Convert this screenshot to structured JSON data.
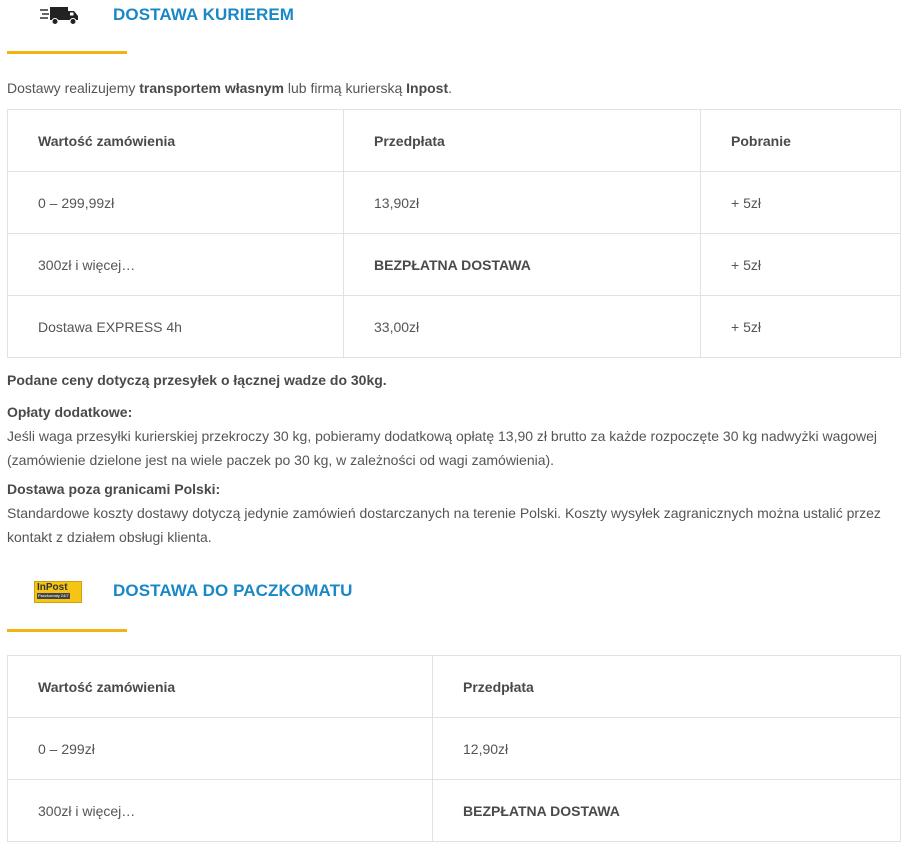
{
  "courier": {
    "title": "DOSTAWA KURIEREM",
    "icon": "truck-icon",
    "intro": {
      "t1": "Dostawy realizujemy ",
      "b1": "transportem własnym",
      "t2": " lub firmą kurierską ",
      "b2": "Inpost",
      "t3": "."
    },
    "table": {
      "headers": [
        "Wartość zamówienia",
        "Przedpłata",
        "Pobranie"
      ],
      "rows": [
        [
          "0 – 299,99zł",
          "13,90zł",
          "+ 5zł"
        ],
        [
          "300zł i więcej…",
          "BEZPŁATNA DOSTAWA",
          "+ 5zł"
        ],
        [
          "Dostawa EXPRESS 4h",
          "33,00zł",
          "+ 5zł"
        ]
      ]
    },
    "weight_note": "Podane ceny dotyczą przesyłek o łącznej wadze do 30kg.",
    "extra_fees": {
      "title": "Opłaty dodatkowe:",
      "line1": "Jeśli waga przesyłki kurierskiej przekroczy 30 kg, pobieramy dodatkową opłatę 13,90 zł brutto za każde rozpoczęte 30 kg nadwyżki wagowej",
      "line2": "(zamówienie dzielone jest na wiele paczek po 30 kg, w zależności od wagi zamówienia)."
    },
    "abroad": {
      "title": "Dostawa poza granicami Polski:",
      "line1": "Standardowe koszty dostawy dotyczą jedynie zamówień dostarczanych na terenie Polski. Koszty wysyłek zagranicznych można ustalić przez",
      "line2": "kontakt z działem obsługi klienta."
    }
  },
  "parcel": {
    "title": "DOSTAWA DO PACZKOMATU",
    "logo": {
      "text": "InPost",
      "sub": "Paczkomaty 24/7"
    },
    "table": {
      "headers": [
        "Wartość zamówienia",
        "Przedpłata"
      ],
      "rows": [
        [
          "0 – 299zł",
          "12,90zł"
        ],
        [
          "300zł i więcej…",
          "BEZPŁATNA DOSTAWA"
        ]
      ]
    }
  },
  "colors": {
    "accent": "#f0b30f",
    "title": "#1a87c6",
    "text": "#555555",
    "border": "#e2e2e2"
  }
}
